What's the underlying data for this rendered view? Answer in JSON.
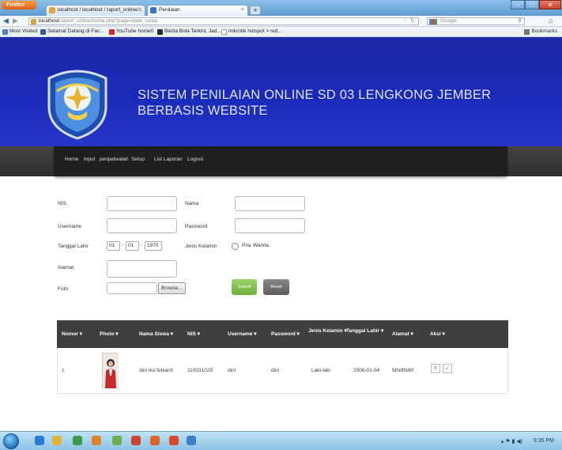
{
  "browser": {
    "firefox_menu": "Firefox",
    "tabs": [
      {
        "title": "localhost / localhost / raport_online/..."
      },
      {
        "title": "Penilaian"
      }
    ],
    "url_host": "localhost",
    "url_path": "/raport_online/home.php?page=data_siswa",
    "search_engine": "Google",
    "bookmarks": [
      {
        "label": "Most Visited"
      },
      {
        "label": "Selamat Datang di Fac..."
      },
      {
        "label": "YouTube home0"
      },
      {
        "label": "Berita Bola Terkini, Jad..."
      },
      {
        "label": "mikrotik hotspot > red..."
      }
    ],
    "bookmarks_menu": "Bookmarks"
  },
  "header": {
    "title_line1": "SISTEM PENILAIAN ONLINE SD 03 LENGKONG JEMBER",
    "title_line2": "BERBASIS WEBSITE"
  },
  "menu": [
    {
      "label": "Home"
    },
    {
      "label": "Input"
    },
    {
      "label": "penjadwalan"
    },
    {
      "label": "Setup"
    },
    {
      "label": "List Laporan"
    },
    {
      "label": "Logout"
    }
  ],
  "form": {
    "nis_label": "NIS",
    "nama_label": "Nama",
    "username_label": "Username",
    "password_label": "Password",
    "tanggal_label": "Tanggal Lahir",
    "day_value": "01",
    "month_value": "01",
    "year_value": "1970",
    "gender_label": "Jenis Kelamin",
    "gender_options": [
      "Pria",
      "Wanita"
    ],
    "alamat_label": "Alamat",
    "foto_label": "Foto",
    "browse_label": "Browse...",
    "submit_label": "Submit",
    "reset_label": "Reset"
  },
  "table": {
    "headers": [
      "Nomor",
      "Photo",
      "Nama Siswa",
      "NIS",
      "Username",
      "Password",
      "Jenis Kelamin",
      "Tanggal Lahir",
      "Alamat",
      "Aksi"
    ],
    "rows": [
      {
        "nomor": "1",
        "nama": "dini ika febianti",
        "nis": "110031029",
        "username": "dini",
        "password": "dini",
        "jenis_kelamin": "Laki-laki",
        "tanggal_lahir": "2006-01-04",
        "alamat": "fdhdfhdhf"
      }
    ]
  },
  "taskbar": {
    "clock": "9:35 PM"
  },
  "colors": {
    "banner": "#1d28a3",
    "menu_bar": "#1f1f1f",
    "submit": "#7dbf45",
    "reset": "#6b6b6b",
    "table_header": "#3f3f3f"
  }
}
